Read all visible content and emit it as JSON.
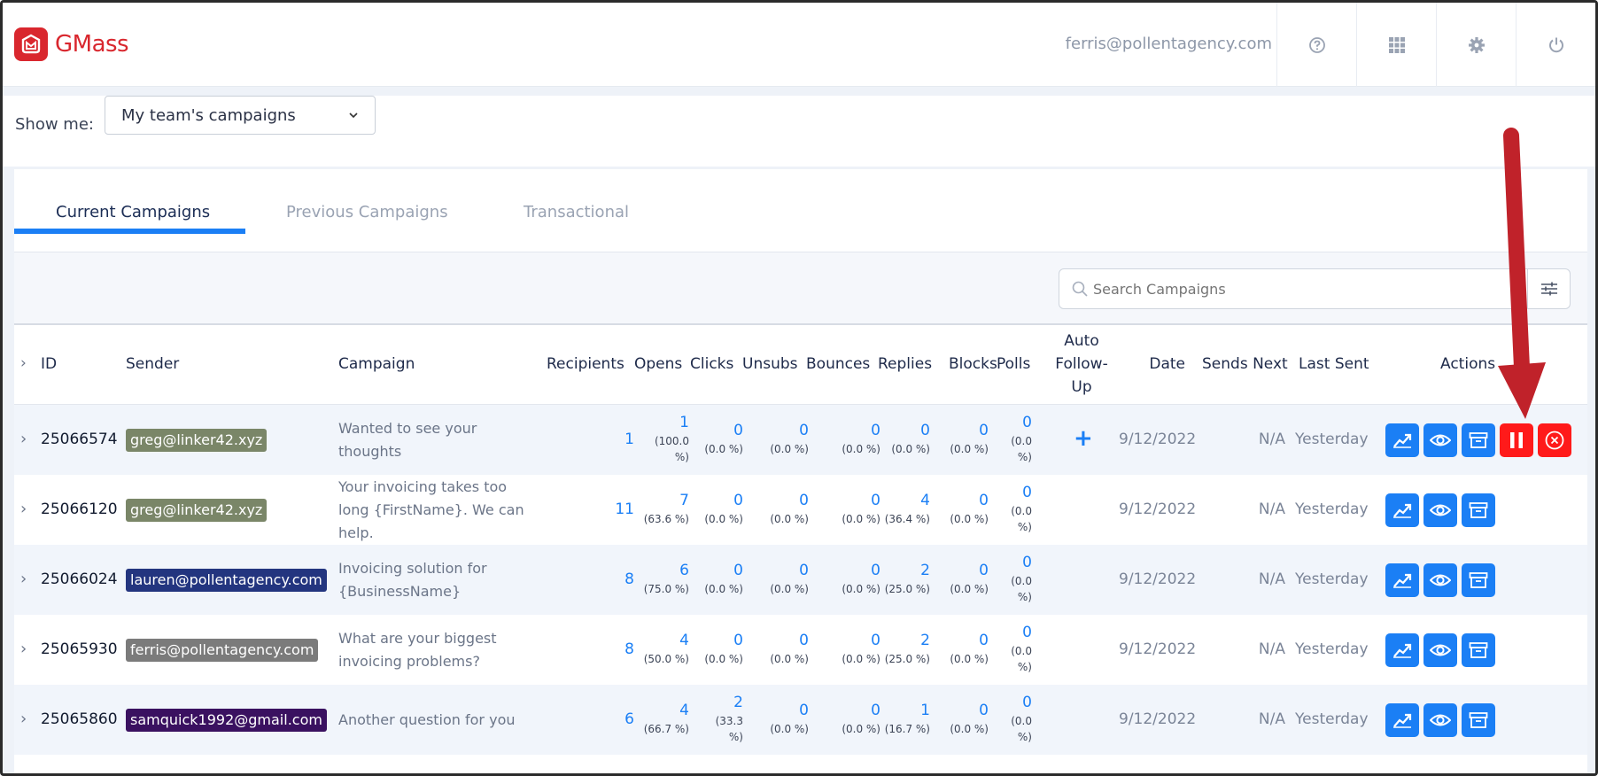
{
  "app": {
    "name": "GMass",
    "user_email": "ferris@pollentagency.com"
  },
  "header_icons": [
    "help-icon",
    "apps-grid-icon",
    "gear-icon",
    "power-icon"
  ],
  "filter": {
    "label": "Show me:",
    "selected": "My team's campaigns"
  },
  "tabs": [
    "Current Campaigns",
    "Previous Campaigns",
    "Transactional"
  ],
  "search": {
    "placeholder": "Search Campaigns"
  },
  "columns": {
    "id": "ID",
    "sender": "Sender",
    "campaign": "Campaign",
    "recipients": "Recipients",
    "opens": "Opens",
    "clicks": "Clicks",
    "unsubs": "Unsubs",
    "bounces": "Bounces",
    "replies": "Replies",
    "blocks": "Blocks",
    "polls": "Polls",
    "auto_followup": [
      "Auto",
      "Follow-",
      "Up"
    ],
    "date": "Date",
    "sends_next": "Sends Next",
    "last_sent": "Last Sent",
    "actions": "Actions"
  },
  "rows": [
    {
      "id": "25066574",
      "sender": "greg@linker42.xyz",
      "sender_color": "#7a8668",
      "campaign": [
        "Wanted to see your",
        "thoughts"
      ],
      "recipients": "1",
      "opens": [
        "1",
        "(100.0",
        "%)"
      ],
      "clicks": [
        "0",
        "(0.0 %)"
      ],
      "unsubs": [
        "0",
        "(0.0 %)"
      ],
      "bounces": [
        "0",
        "(0.0 %)"
      ],
      "replies": [
        "0",
        "(0.0 %)"
      ],
      "blocks": [
        "0",
        "(0.0 %)"
      ],
      "polls": [
        "0",
        "(0.0",
        "%)"
      ],
      "auto_followup": "+",
      "date": "9/12/2022",
      "sends_next": "N/A",
      "last_sent": "Yesterday"
    },
    {
      "id": "25066120",
      "sender": "greg@linker42.xyz",
      "sender_color": "#7a8668",
      "campaign": [
        "Your invoicing takes too",
        "long {FirstName}. We can",
        "help."
      ],
      "recipients": "11",
      "opens": [
        "7",
        "(63.6 %)"
      ],
      "clicks": [
        "0",
        "(0.0 %)"
      ],
      "unsubs": [
        "0",
        "(0.0 %)"
      ],
      "bounces": [
        "0",
        "(0.0 %)"
      ],
      "replies": [
        "4",
        "(36.4 %)"
      ],
      "blocks": [
        "0",
        "(0.0 %)"
      ],
      "polls": [
        "0",
        "(0.0",
        "%)"
      ],
      "date": "9/12/2022",
      "sends_next": "N/A",
      "last_sent": "Yesterday"
    },
    {
      "id": "25066024",
      "sender": "lauren@pollentagency.com",
      "sender_color": "#23357f",
      "campaign": [
        "Invoicing solution for",
        "{BusinessName}"
      ],
      "recipients": "8",
      "opens": [
        "6",
        "(75.0 %)"
      ],
      "clicks": [
        "0",
        "(0.0 %)"
      ],
      "unsubs": [
        "0",
        "(0.0 %)"
      ],
      "bounces": [
        "0",
        "(0.0 %)"
      ],
      "replies": [
        "2",
        "(25.0 %)"
      ],
      "blocks": [
        "0",
        "(0.0 %)"
      ],
      "polls": [
        "0",
        "(0.0",
        "%)"
      ],
      "date": "9/12/2022",
      "sends_next": "N/A",
      "last_sent": "Yesterday"
    },
    {
      "id": "25065930",
      "sender": "ferris@pollentagency.com",
      "sender_color": "#7b7b7b",
      "campaign": [
        "What are your biggest",
        "invoicing problems?"
      ],
      "recipients": "8",
      "opens": [
        "4",
        "(50.0 %)"
      ],
      "clicks": [
        "0",
        "(0.0 %)"
      ],
      "unsubs": [
        "0",
        "(0.0 %)"
      ],
      "bounces": [
        "0",
        "(0.0 %)"
      ],
      "replies": [
        "2",
        "(25.0 %)"
      ],
      "blocks": [
        "0",
        "(0.0 %)"
      ],
      "polls": [
        "0",
        "(0.0",
        "%)"
      ],
      "date": "9/12/2022",
      "sends_next": "N/A",
      "last_sent": "Yesterday"
    },
    {
      "id": "25065860",
      "sender": "samquick1992@gmail.com",
      "sender_color": "#3a1160",
      "campaign": [
        "Another question for you"
      ],
      "recipients": "6",
      "opens": [
        "4",
        "(66.7 %)"
      ],
      "clicks": [
        "2",
        "(33.3",
        "%)"
      ],
      "unsubs": [
        "0",
        "(0.0 %)"
      ],
      "bounces": [
        "0",
        "(0.0 %)"
      ],
      "replies": [
        "1",
        "(16.7 %)"
      ],
      "blocks": [
        "0",
        "(0.0 %)"
      ],
      "polls": [
        "0",
        "(0.0",
        "%)"
      ],
      "date": "9/12/2022",
      "sends_next": "N/A",
      "last_sent": "Yesterday"
    }
  ],
  "actions": [
    "reports-icon",
    "view-icon",
    "archive-icon",
    "pause-icon",
    "cancel-icon"
  ],
  "colors": {
    "brand": "#d9272e",
    "accent": "#1b7ff5",
    "danger": "#ff1a1a",
    "arrow": "#c0222a"
  }
}
